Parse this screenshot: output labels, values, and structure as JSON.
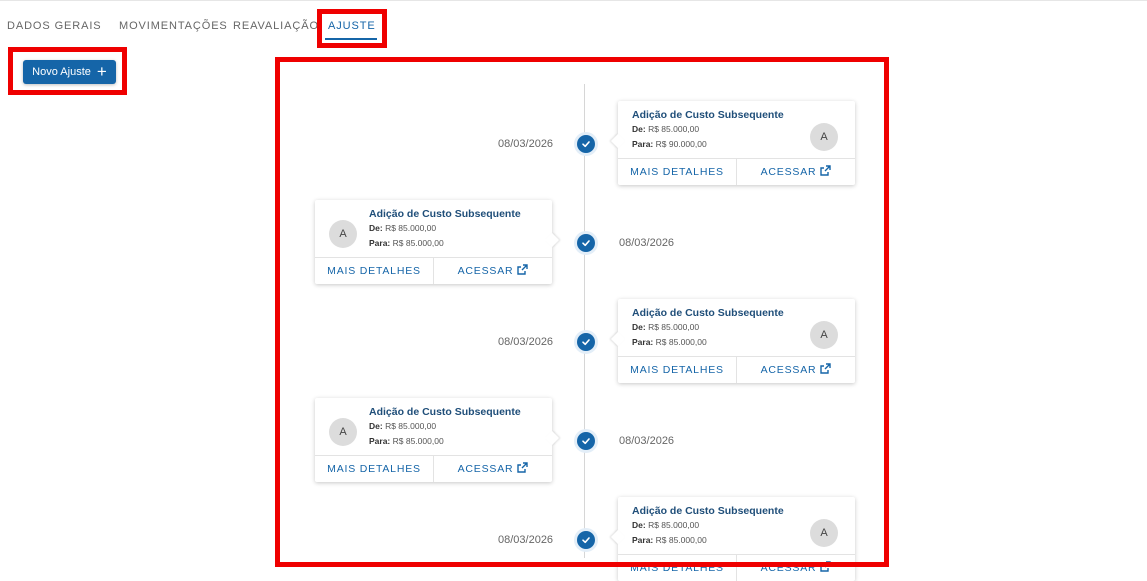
{
  "tabs": [
    {
      "label": "DADOS GERAIS",
      "active": false
    },
    {
      "label": "MOVIMENTAÇÕES",
      "active": false
    },
    {
      "label": "REAVALIAÇÃO",
      "active": false
    },
    {
      "label": "AJUSTE",
      "active": true
    }
  ],
  "new_button": {
    "label": "Novo Ajuste",
    "icon": "plus-icon"
  },
  "colors": {
    "primary": "#1565a8",
    "highlight": "#ef0000"
  },
  "timeline": [
    {
      "date": "08/03/2026",
      "title": "Adição de Custo Subsequente",
      "de_label": "De:",
      "de": "R$ 85.000,00",
      "para_label": "Para:",
      "para": "R$ 90.000,00",
      "avatar": "A",
      "details": "MAIS DETALHES",
      "access": "ACESSAR",
      "side": "right"
    },
    {
      "date": "08/03/2026",
      "title": "Adição de Custo Subsequente",
      "de_label": "De:",
      "de": "R$ 85.000,00",
      "para_label": "Para:",
      "para": "R$ 85.000,00",
      "avatar": "A",
      "details": "MAIS DETALHES",
      "access": "ACESSAR",
      "side": "left"
    },
    {
      "date": "08/03/2026",
      "title": "Adição de Custo Subsequente",
      "de_label": "De:",
      "de": "R$ 85.000,00",
      "para_label": "Para:",
      "para": "R$ 85.000,00",
      "avatar": "A",
      "details": "MAIS DETALHES",
      "access": "ACESSAR",
      "side": "right"
    },
    {
      "date": "08/03/2026",
      "title": "Adição de Custo Subsequente",
      "de_label": "De:",
      "de": "R$ 85.000,00",
      "para_label": "Para:",
      "para": "R$ 85.000,00",
      "avatar": "A",
      "details": "MAIS DETALHES",
      "access": "ACESSAR",
      "side": "left"
    },
    {
      "date": "08/03/2026",
      "title": "Adição de Custo Subsequente",
      "de_label": "De:",
      "de": "R$ 85.000,00",
      "para_label": "Para:",
      "para": "R$ 85.000,00",
      "avatar": "A",
      "details": "MAIS DETALHES",
      "access": "ACESSAR",
      "side": "right"
    }
  ]
}
